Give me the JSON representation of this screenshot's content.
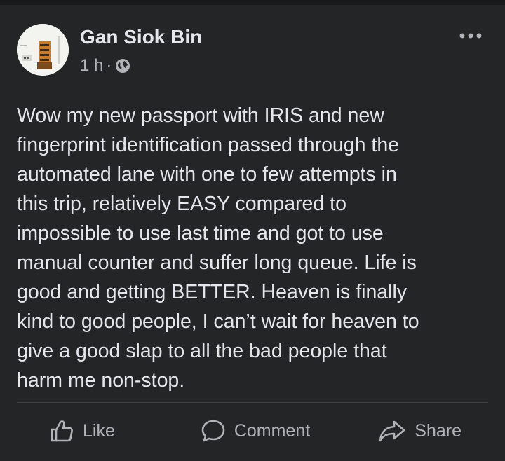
{
  "post": {
    "author": "Gan Siok Bin",
    "time": "1 h",
    "separator": "·",
    "privacy_icon": "globe-icon",
    "more_icon": "more-options-icon",
    "body_lines": [
      "Wow my new passport with IRIS and new",
      "fingerprint identification passed through the",
      "automated lane with one to few attempts in",
      "this trip, relatively EASY compared to",
      "impossible to use last time and got to use",
      "manual counter and suffer long queue. Life is",
      "good and getting BETTER. Heaven is finally",
      "kind to good people, I can’t wait for heaven to",
      "give a good slap to all the bad people that",
      "harm me non-stop."
    ]
  },
  "actions": {
    "like": "Like",
    "comment": "Comment",
    "share": "Share"
  },
  "colors": {
    "background": "#18191a",
    "card": "#242526",
    "primary_text": "#e4e6eb",
    "secondary_text": "#b0b3b8",
    "divider": "#3e4042"
  }
}
